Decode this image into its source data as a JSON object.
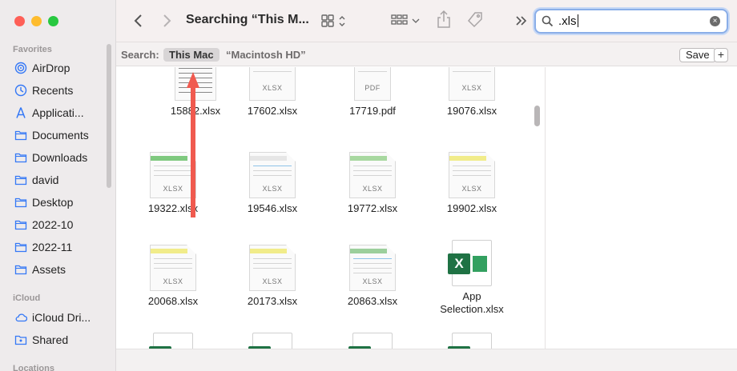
{
  "window": {
    "title": "Searching “This M..."
  },
  "sidebar": {
    "sections": {
      "favorites": "Favorites",
      "icloud": "iCloud",
      "locations": "Locations"
    },
    "favorites": [
      {
        "label": "AirDrop",
        "icon": "airdrop-icon"
      },
      {
        "label": "Recents",
        "icon": "clock-icon"
      },
      {
        "label": "Applicati...",
        "icon": "applications-icon"
      },
      {
        "label": "Documents",
        "icon": "folder-icon"
      },
      {
        "label": "Downloads",
        "icon": "folder-icon"
      },
      {
        "label": "david",
        "icon": "folder-icon"
      },
      {
        "label": "Desktop",
        "icon": "folder-icon"
      },
      {
        "label": "2022-10",
        "icon": "folder-icon"
      },
      {
        "label": "2022-11",
        "icon": "folder-icon"
      },
      {
        "label": "Assets",
        "icon": "folder-icon"
      }
    ],
    "icloud": [
      {
        "label": "iCloud Dri...",
        "icon": "cloud-icon"
      },
      {
        "label": "Shared",
        "icon": "shared-folder-icon"
      }
    ]
  },
  "search": {
    "value": ".xls"
  },
  "scope": {
    "label": "Search:",
    "selected": "This Mac",
    "alternate": "“Macintosh HD”",
    "save": "Save",
    "add": "+"
  },
  "files": [
    {
      "name": "15882.xlsx",
      "kind": "xlsx-text"
    },
    {
      "name": "17602.xlsx",
      "kind": "xlsx"
    },
    {
      "name": "17719.pdf",
      "kind": "pdf"
    },
    {
      "name": "19076.xlsx",
      "kind": "xlsx"
    },
    {
      "name": "19322.xlsx",
      "kind": "xlsx-green"
    },
    {
      "name": "19546.xlsx",
      "kind": "xlsx-blue"
    },
    {
      "name": "19772.xlsx",
      "kind": "xlsx-green"
    },
    {
      "name": "19902.xlsx",
      "kind": "xlsx-yellow"
    },
    {
      "name": "20068.xlsx",
      "kind": "xlsx-yellow"
    },
    {
      "name": "20173.xlsx",
      "kind": "xlsx-yellow"
    },
    {
      "name": "20863.xlsx",
      "kind": "xlsx-grid"
    },
    {
      "name": "App Selection.xlsx",
      "kind": "excel"
    }
  ],
  "colors": {
    "accent": "#8aaee8",
    "arrow": "#f05a4f",
    "excel": "#1f7244",
    "sidebar_icon": "#3478f6"
  }
}
